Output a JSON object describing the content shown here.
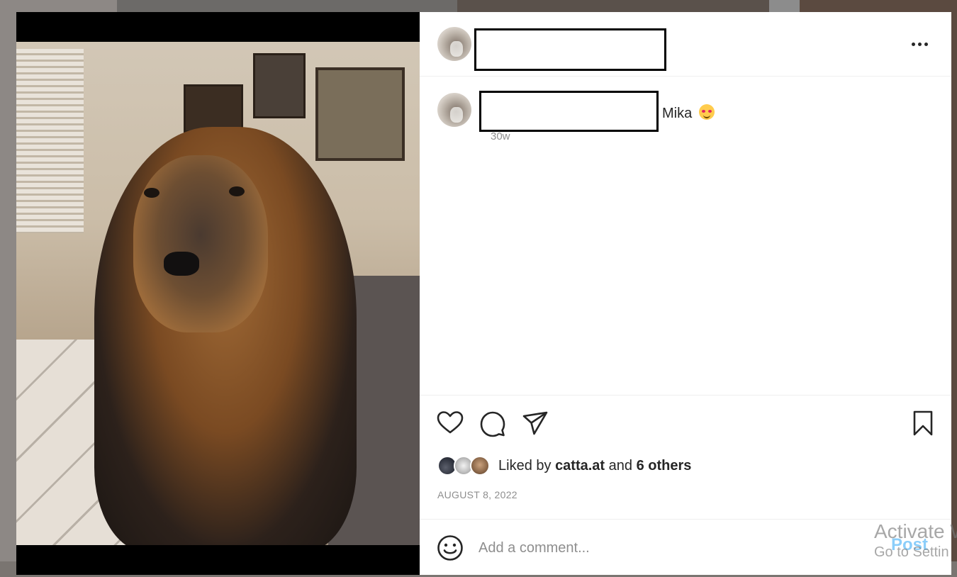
{
  "header": {
    "username": "",
    "more_icon": "more-horizontal-icon"
  },
  "post": {
    "caption_author": "",
    "caption_text": "Mika",
    "caption_emoji": "smiling-face-with-hearts-emoji",
    "time_ago": "30w"
  },
  "actions": {
    "like_icon": "heart-icon",
    "comment_icon": "comment-bubble-icon",
    "share_icon": "paper-plane-icon",
    "save_icon": "bookmark-icon"
  },
  "likes": {
    "prefix": "Liked by",
    "user": "catta.at",
    "conjunction": "and",
    "others": "6 others"
  },
  "date": "AUGUST 8, 2022",
  "comment_box": {
    "placeholder": "Add a comment...",
    "post_label": "Post",
    "emoji_icon": "smiley-icon"
  },
  "watermark": {
    "line1": "Activate W",
    "line2": "Go to Settin"
  },
  "colors": {
    "accent": "#0095f6",
    "text": "#262626",
    "muted": "#8e8e8e",
    "border": "#efefef"
  }
}
